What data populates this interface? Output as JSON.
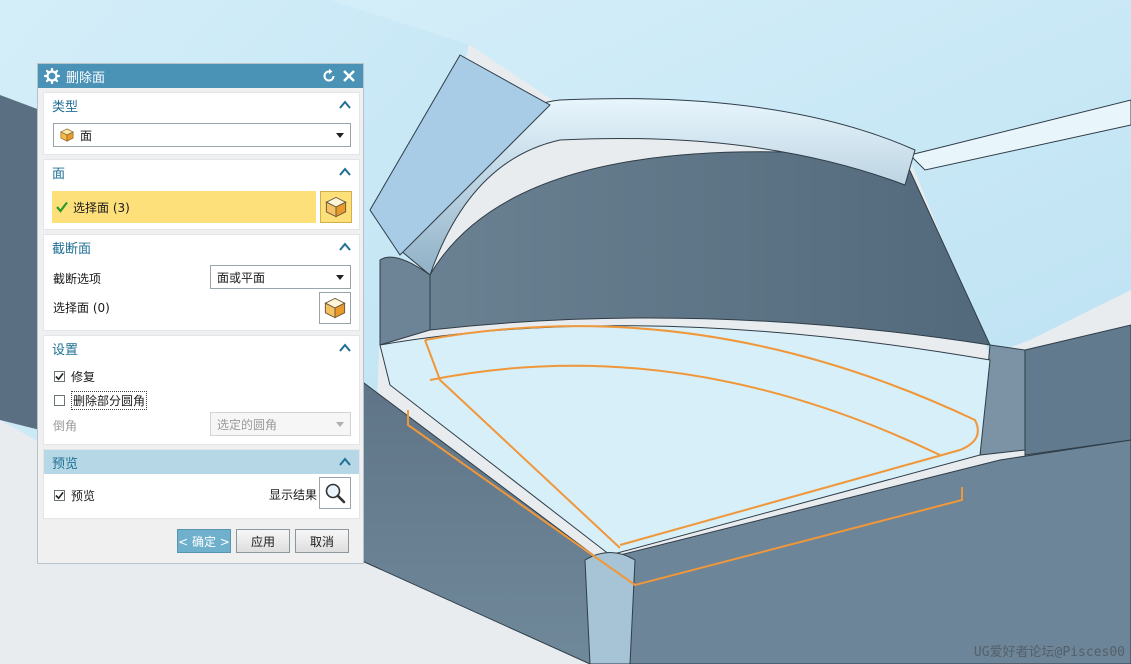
{
  "dialog": {
    "title": "删除面",
    "sections": {
      "type": {
        "header": "类型",
        "selected": "面"
      },
      "face": {
        "header": "面",
        "select_label": "选择面 (3)"
      },
      "cutface": {
        "header": "截断面",
        "option_label": "截断选项",
        "option_value": "面或平面",
        "select_label": "选择面 (0)"
      },
      "settings": {
        "header": "设置",
        "repair_label": "修复",
        "repair_checked": true,
        "delete_partial_label": "删除部分圆角",
        "delete_partial_checked": false,
        "chamfer_label": "倒角",
        "chamfer_value": "选定的圆角"
      },
      "preview": {
        "header": "预览",
        "preview_label": "预览",
        "preview_checked": true,
        "show_result_label": "显示结果"
      }
    },
    "buttons": {
      "ok": "< 确定 >",
      "apply": "应用",
      "cancel": "取消"
    }
  },
  "watermark": "UG爱好者论坛@Pisces00",
  "colors": {
    "titlebar": "#4a93b7",
    "section_header_text": "#1f6f93",
    "selected_row": "#fde07a",
    "preview_header": "#b6d8e6",
    "highlight_edge": "#f0973a",
    "part_top": "#cfeaf7",
    "part_wall": "#6a8294"
  }
}
